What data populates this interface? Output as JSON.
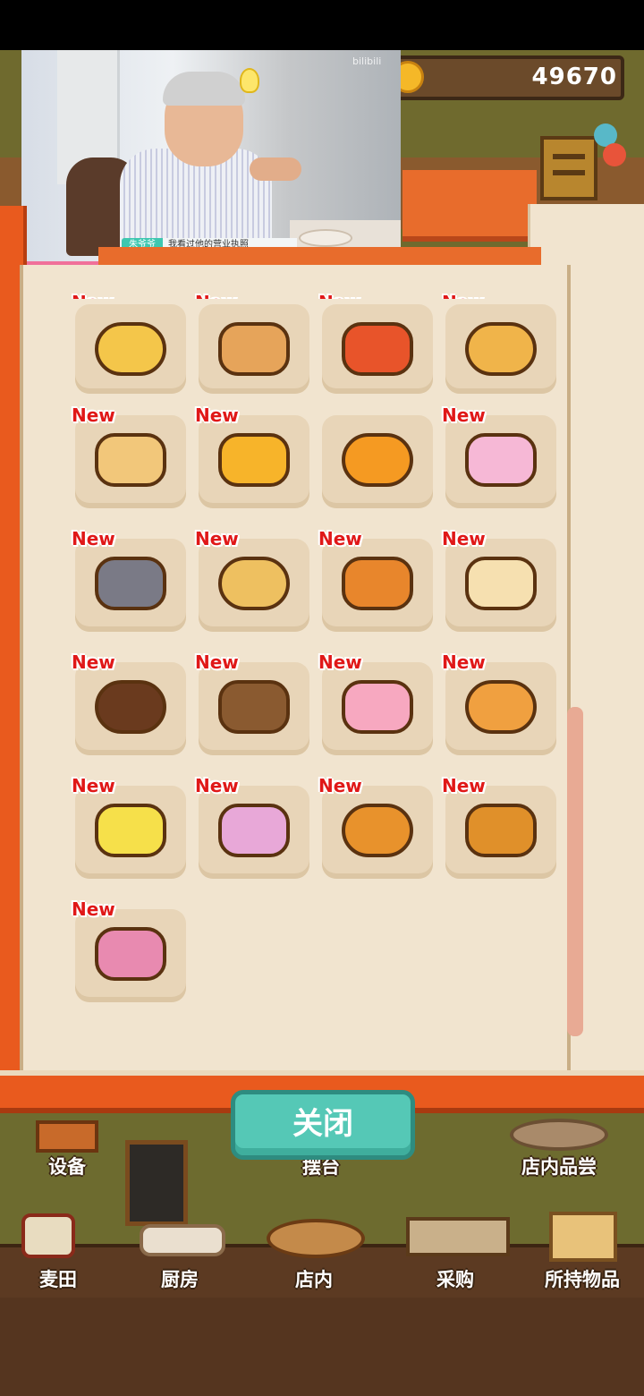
{
  "hud": {
    "coins": "49670"
  },
  "video": {
    "platform_logo": "bilibili",
    "speaker_name": "朱爷爷",
    "subtitle": "我看过他的营业执照",
    "progress_percent": 32
  },
  "book": {
    "items": [
      {
        "new": "New",
        "name": "bread-1",
        "color": "#f4c64a",
        "clipped": true
      },
      {
        "new": "New",
        "name": "bread-2",
        "color": "#e6a45a",
        "clipped": true
      },
      {
        "new": "New",
        "name": "bread-3",
        "color": "#e8542a",
        "clipped": true
      },
      {
        "new": "New",
        "name": "bread-4",
        "color": "#f0b44a",
        "clipped": true
      },
      {
        "new": "New",
        "name": "sandwich",
        "color": "#f2c77a"
      },
      {
        "new": "New",
        "name": "chick-bun",
        "color": "#f7b42a"
      },
      {
        "new": "",
        "name": "pumpkin-bun",
        "color": "#f59a22"
      },
      {
        "new": "New",
        "name": "pink-bun",
        "color": "#f6b8d6"
      },
      {
        "new": "New",
        "name": "cat-bun",
        "color": "#7a7a86"
      },
      {
        "new": "New",
        "name": "pizza-bread",
        "color": "#eec060"
      },
      {
        "new": "New",
        "name": "reindeer-bun",
        "color": "#e8862c"
      },
      {
        "new": "New",
        "name": "santa-bun",
        "color": "#f6e0b0"
      },
      {
        "new": "New",
        "name": "chocolate-pudding",
        "color": "#6a3a1e"
      },
      {
        "new": "New",
        "name": "cherry-roll",
        "color": "#8a5a30"
      },
      {
        "new": "New",
        "name": "heart-bun",
        "color": "#f7a8c0"
      },
      {
        "new": "New",
        "name": "taiyaki",
        "color": "#f0a040"
      },
      {
        "new": "New",
        "name": "lemon-bun",
        "color": "#f6e04a"
      },
      {
        "new": "New",
        "name": "rainbow-bun",
        "color": "#e8a8d8"
      },
      {
        "new": "New",
        "name": "acorn-bun",
        "color": "#e8922c"
      },
      {
        "new": "New",
        "name": "melon-pan",
        "color": "#e0902a"
      },
      {
        "new": "New",
        "name": "mushroom-bun",
        "color": "#e88ab0"
      }
    ],
    "scroll_position": 0.85
  },
  "close_button": {
    "label": "关闭"
  },
  "bottom": {
    "equipment": "设备",
    "tasting": "店内品尝",
    "display": "摆台",
    "nav": [
      {
        "label": "麦田"
      },
      {
        "label": "厨房"
      },
      {
        "label": "店内"
      },
      {
        "label": "采购"
      },
      {
        "label": "所持物品"
      }
    ]
  },
  "colors": {
    "book_orange": "#e95a1e",
    "page": "#f1e4cf",
    "slot": "#e8d5b8",
    "new_tag": "#e01818",
    "close_button": "#55c8b6"
  }
}
